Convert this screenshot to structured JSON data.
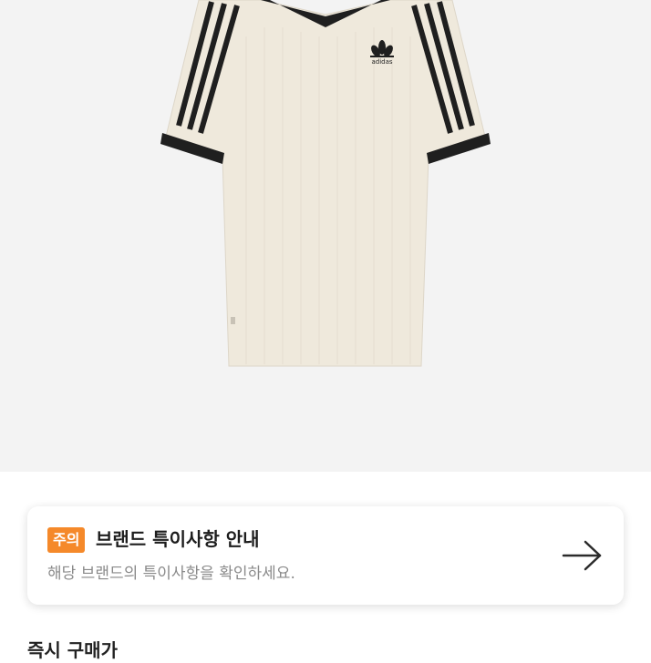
{
  "product": {
    "image_alt": "adidas",
    "brand_text": "adidas"
  },
  "notice": {
    "badge": "주의",
    "title": "브랜드 특이사항 안내",
    "subtitle": "해당 브랜드의 특이사항을 확인하세요.",
    "arrow_icon": "arrow-right-icon"
  },
  "footer": {
    "partial_text": "즉시 구매가"
  },
  "colors": {
    "badge": "#f5892a",
    "shirt": "#efe9dc",
    "trim": "#1f1f1f"
  }
}
